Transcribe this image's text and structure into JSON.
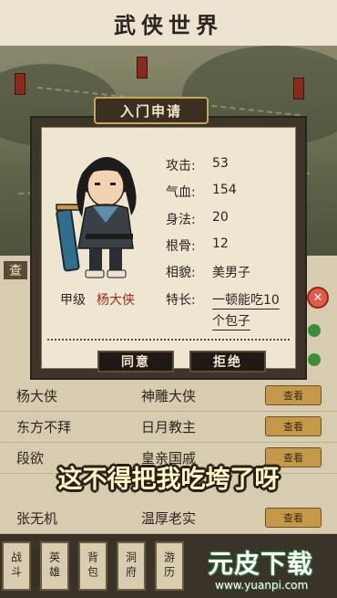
{
  "title": "武侠世界",
  "dialog": {
    "header": "入门申请",
    "hero": {
      "rank": "甲级",
      "name": "杨大侠"
    },
    "stats": [
      {
        "label": "攻击:",
        "value": "53"
      },
      {
        "label": "气血:",
        "value": "154"
      },
      {
        "label": "身法:",
        "value": "20"
      },
      {
        "label": "根骨:",
        "value": "12"
      },
      {
        "label": "相貌:",
        "value": "美男子"
      },
      {
        "label": "特长:",
        "value_line1": "一顿能吃10",
        "value_line2": "个包子"
      }
    ],
    "buttons": {
      "agree": "同意",
      "reject": "拒绝"
    }
  },
  "list": {
    "tab": "查",
    "rows": [
      {
        "name": "杨大侠",
        "trait": "神雕大侠",
        "action": "查看"
      },
      {
        "name": "东方不拜",
        "trait": "日月教主",
        "action": "查看"
      },
      {
        "name": "段欲",
        "trait": "皇亲国戚",
        "action": "查看"
      },
      {
        "name": "张无机",
        "trait": "温厚老实",
        "action": "查看"
      }
    ]
  },
  "nav": [
    "战斗",
    "英雄",
    "背包",
    "洞府",
    "游历"
  ],
  "caption": "这不得把我吃垮了呀",
  "watermark": {
    "brand": "元皮下载",
    "url": "www.yuanpi.com"
  },
  "colors": {
    "accent_red": "#a8261d",
    "panel_dark": "#3d342a",
    "paper": "#efe6d2"
  }
}
